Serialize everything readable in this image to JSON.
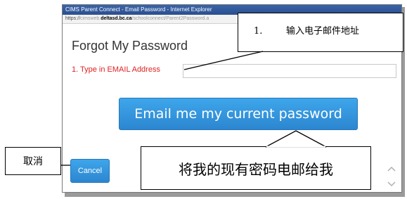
{
  "window": {
    "title": "CIMS Parent Connect - Email Password - Internet Explorer",
    "url_scheme": "https://",
    "url_pre": "cimsweb.",
    "url_host": "deltasd.bc.ca",
    "url_path": "/schoolconnect/Parent2Password.a"
  },
  "form": {
    "title": "Forgot My Password",
    "email_label": "1. Type in EMAIL Address",
    "email_value": "",
    "submit_label": "Email me my current password",
    "cancel_label": "Cancel"
  },
  "annotations": {
    "email_number": "1.",
    "email_text": "输入电子邮件地址",
    "submit_text": "将我的现有密码电邮给我",
    "cancel_text": "取消"
  },
  "colors": {
    "label_red": "#e02020",
    "button_blue": "#3399e0"
  }
}
